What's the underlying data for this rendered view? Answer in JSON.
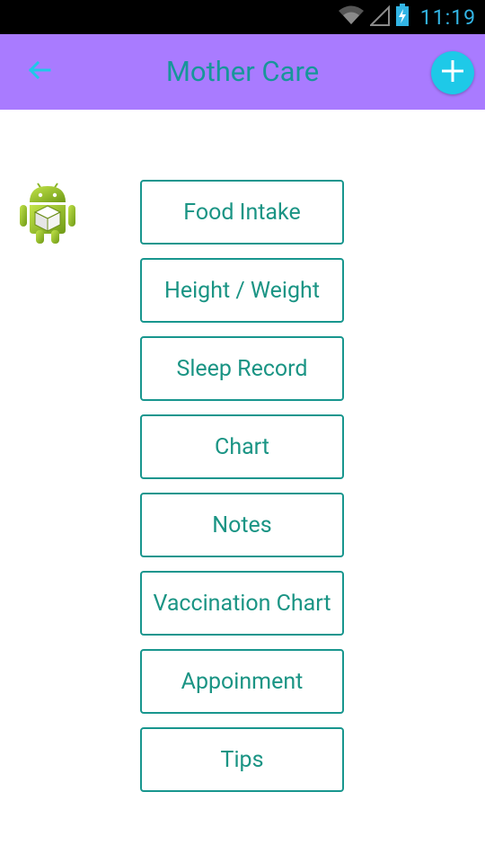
{
  "status_bar": {
    "time": "11:19",
    "icons": [
      "wifi-icon",
      "cell-signal-icon",
      "battery-charging-icon"
    ]
  },
  "app_bar": {
    "title": "Mother Care",
    "back_icon": "arrow-left-icon",
    "add_icon": "plus-icon",
    "background_color": "#a97bff",
    "title_color": "#17969a",
    "add_button_color": "#1ec9e8"
  },
  "logo": {
    "icon": "android-robot-icon"
  },
  "menu": {
    "items": [
      {
        "label": "Food Intake"
      },
      {
        "label": "Height / Weight"
      },
      {
        "label": "Sleep Record"
      },
      {
        "label": "Chart"
      },
      {
        "label": "Notes"
      },
      {
        "label": "Vaccination Chart"
      },
      {
        "label": "Appoinment"
      },
      {
        "label": "Tips"
      }
    ],
    "border_color": "#18968e",
    "text_color": "#1a9484"
  }
}
